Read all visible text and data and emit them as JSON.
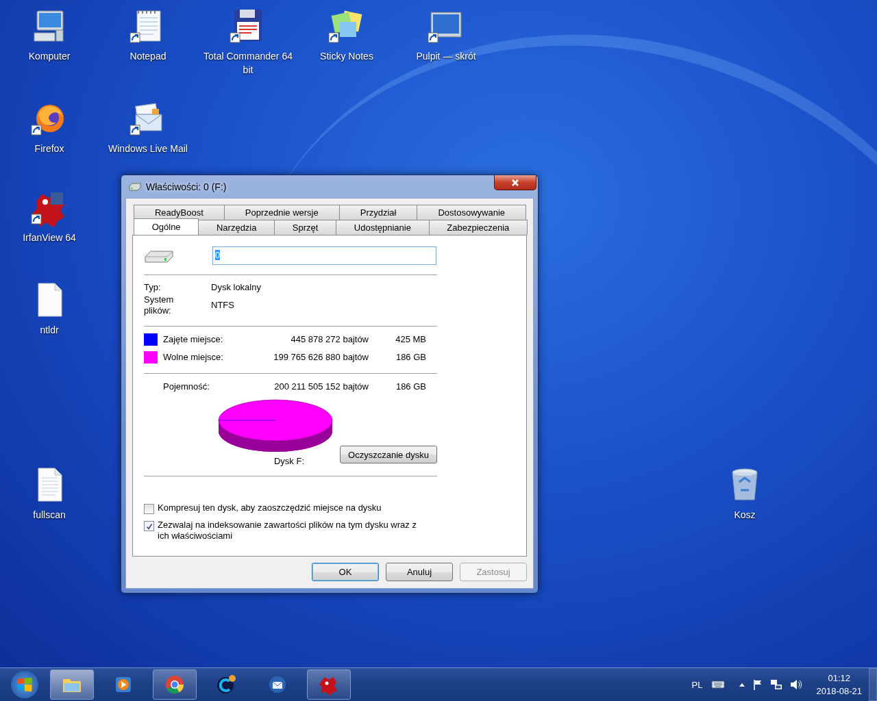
{
  "desktop": {
    "icons": [
      {
        "label": "Komputer",
        "kind": "computer",
        "shortcut": false
      },
      {
        "label": "Notepad",
        "kind": "notepad",
        "shortcut": true
      },
      {
        "label": "Total Commander 64 bit",
        "kind": "floppy",
        "shortcut": true
      },
      {
        "label": "Sticky Notes",
        "kind": "notes",
        "shortcut": true
      },
      {
        "label": "Pulpit — skrót",
        "kind": "screen",
        "shortcut": true
      },
      {
        "label": "Firefox",
        "kind": "firefox",
        "shortcut": true
      },
      {
        "label": "Windows Live Mail",
        "kind": "mail",
        "shortcut": true
      },
      {
        "label": "IrfanView 64",
        "kind": "irfanview",
        "shortcut": true
      },
      {
        "label": "ntldr",
        "kind": "file",
        "shortcut": false
      },
      {
        "label": "fullscan",
        "kind": "textfile",
        "shortcut": false
      },
      {
        "label": "Kosz",
        "kind": "recycle",
        "shortcut": false
      }
    ]
  },
  "dialog": {
    "title": "Właściwości: 0 (F:)",
    "tab_rows": [
      [
        {
          "label": "ReadyBoost",
          "selected": false
        },
        {
          "label": "Poprzednie wersje",
          "selected": false
        },
        {
          "label": "Przydział",
          "selected": false
        },
        {
          "label": "Dostosowywanie",
          "selected": false
        }
      ],
      [
        {
          "label": "Ogólne",
          "selected": true
        },
        {
          "label": "Narzędzia",
          "selected": false
        },
        {
          "label": "Sprzęt",
          "selected": false
        },
        {
          "label": "Udostępnianie",
          "selected": false
        },
        {
          "label": "Zabezpieczenia",
          "selected": false
        }
      ]
    ],
    "name_field": {
      "value": "0"
    },
    "type": {
      "label": "Typ:",
      "value": "Dysk lokalny"
    },
    "file_system": {
      "label": "System plików:",
      "value": "NTFS"
    },
    "space": [
      {
        "label": "Zajęte miejsce:",
        "bytes": "445 878 272 bajtów",
        "size": "425 MB",
        "color": "#0000ff"
      },
      {
        "label": "Wolne miejsce:",
        "bytes": "199 765 626 880 bajtów",
        "size": "186 GB",
        "color": "#ff00ff"
      }
    ],
    "capacity": {
      "label": "Pojemność:",
      "bytes": "200 211 505 152 bajtów",
      "size": "186 GB"
    },
    "drive_label": "Dysk F:",
    "cleanup_button": "Oczyszczanie dysku",
    "options": [
      {
        "label": "Kompresuj ten dysk, aby zaoszczędzić miejsce na dysku",
        "checked": false
      },
      {
        "label": "Zezwalaj na indeksowanie zawartości plików na tym dysku wraz z ich właściwościami",
        "checked": true
      }
    ],
    "buttons": [
      {
        "label": "OK",
        "default": true,
        "disabled": false
      },
      {
        "label": "Anuluj",
        "default": false,
        "disabled": false
      },
      {
        "label": "Zastosuj",
        "default": false,
        "disabled": true
      }
    ]
  },
  "taskbar": {
    "items": [
      {
        "kind": "folder",
        "running": true,
        "selected": true
      },
      {
        "kind": "media",
        "running": false,
        "selected": false
      },
      {
        "kind": "chrome",
        "running": true,
        "selected": false
      },
      {
        "kind": "cleaner",
        "running": false,
        "selected": false
      },
      {
        "kind": "mail",
        "running": false,
        "selected": false
      },
      {
        "kind": "irfanview",
        "running": true,
        "selected": false
      }
    ],
    "tray": {
      "language": "PL",
      "time": "01:12",
      "date": "2018-08-21"
    }
  }
}
